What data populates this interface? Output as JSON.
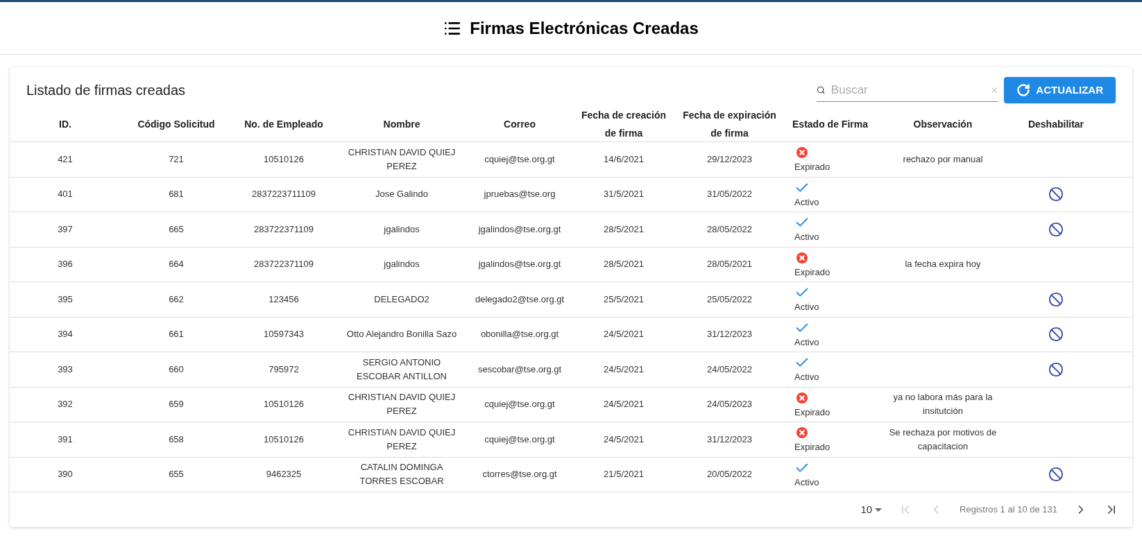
{
  "page_title": "Firmas Electrónicas Creadas",
  "card": {
    "title": "Listado de firmas creadas",
    "search": {
      "placeholder": "Buscar"
    },
    "refresh_button": "ACTUALIZAR"
  },
  "table": {
    "columns": [
      "ID.",
      "Código Solicitud",
      "No. de Empleado",
      "Nombre",
      "Correo",
      "Fecha de creación de firma",
      "Fecha de expiración de firma",
      "Estado de Firma",
      "Observación",
      "Deshabilitar"
    ],
    "rows": [
      {
        "id": "421",
        "code": "721",
        "employee": "10510126",
        "name": "CHRISTIAN DAVID QUIEJ PEREZ",
        "email": "cquiej@tse.org.gt",
        "created": "14/6/2021",
        "expires": "29/12/2023",
        "status": {
          "kind": "expired",
          "label": "Expirado"
        },
        "observation": "rechazo por manual",
        "can_disable": false
      },
      {
        "id": "401",
        "code": "681",
        "employee": "2837223711109",
        "name": "Jose Galindo",
        "email": "jpruebas@tse.org",
        "created": "31/5/2021",
        "expires": "31/05/2022",
        "status": {
          "kind": "active",
          "label": "Activo"
        },
        "can_disable": true
      },
      {
        "id": "397",
        "code": "665",
        "employee": "283722371109",
        "name": "jgalindos",
        "email": "jgalindos@tse.org.gt",
        "created": "28/5/2021",
        "expires": "28/05/2022",
        "status": {
          "kind": "active",
          "label": "Activo"
        },
        "can_disable": true
      },
      {
        "id": "396",
        "code": "664",
        "employee": "283722371109",
        "name": "jgalindos",
        "email": "jgalindos@tse.org.gt",
        "created": "28/5/2021",
        "expires": "28/05/2021",
        "status": {
          "kind": "expired",
          "label": "Expirado"
        },
        "observation": "la fecha expira hoy",
        "can_disable": false
      },
      {
        "id": "395",
        "code": "662",
        "employee": "123456",
        "name": "DELEGADO2",
        "email": "delegado2@tse.org.gt",
        "created": "25/5/2021",
        "expires": "25/05/2022",
        "status": {
          "kind": "active",
          "label": "Activo"
        },
        "can_disable": true
      },
      {
        "id": "394",
        "code": "661",
        "employee": "10597343",
        "name": "Otto Alejandro Bonilla Sazo",
        "email": "obonilla@tse.org.gt",
        "created": "24/5/2021",
        "expires": "31/12/2023",
        "status": {
          "kind": "active",
          "label": "Activo"
        },
        "can_disable": true
      },
      {
        "id": "393",
        "code": "660",
        "employee": "795972",
        "name": "SERGIO ANTONIO ESCOBAR ANTILLON",
        "email": "sescobar@tse.org.gt",
        "created": "24/5/2021",
        "expires": "24/05/2022",
        "status": {
          "kind": "active",
          "label": "Activo"
        },
        "can_disable": true
      },
      {
        "id": "392",
        "code": "659",
        "employee": "10510126",
        "name": "CHRISTIAN DAVID QUIEJ PEREZ",
        "email": "cquiej@tse.org.gt",
        "created": "24/5/2021",
        "expires": "24/05/2023",
        "status": {
          "kind": "expired",
          "label": "Expirado"
        },
        "observation": "ya no labora más para la insitutción",
        "can_disable": false
      },
      {
        "id": "391",
        "code": "658",
        "employee": "10510126",
        "name": "CHRISTIAN DAVID QUIEJ PEREZ",
        "email": "cquiej@tse.org.gt",
        "created": "24/5/2021",
        "expires": "31/12/2023",
        "status": {
          "kind": "expired",
          "label": "Expirado"
        },
        "observation": "Se rechaza por motivos de capacitacion",
        "can_disable": false
      },
      {
        "id": "390",
        "code": "655",
        "employee": "9462325",
        "name": "CATALIN DOMINGA TORRES ESCOBAR",
        "email": "ctorres@tse.org.gt",
        "created": "21/5/2021",
        "expires": "20/05/2022",
        "status": {
          "kind": "active",
          "label": "Activo"
        },
        "can_disable": true
      }
    ]
  },
  "pagination": {
    "page_size": "10",
    "summary": "Registros 1 al 10 de 131"
  }
}
